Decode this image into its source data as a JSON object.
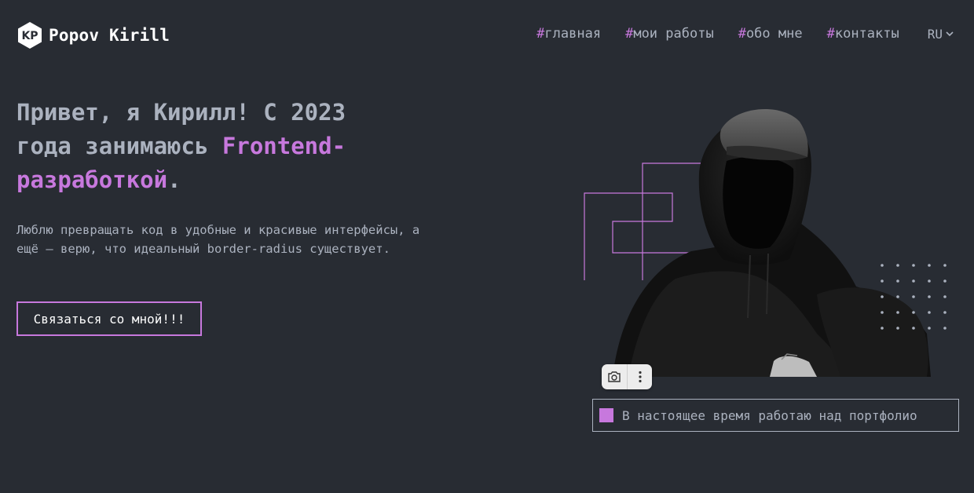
{
  "header": {
    "logo_initials": "KP",
    "logo_name": "Popov Kirill",
    "nav": [
      {
        "hash": "#",
        "label": "главная"
      },
      {
        "hash": "#",
        "label": "мои работы"
      },
      {
        "hash": "#",
        "label": "обо мне"
      },
      {
        "hash": "#",
        "label": "контакты"
      }
    ],
    "language": "RU"
  },
  "hero": {
    "title_part1": "Привет, я Кирилл! С 2023 года занимаюсь ",
    "title_accent": "Frontend-разработкой",
    "title_end": ".",
    "description": "Люблю превращать код в удобные и красивые интерфейсы, а ещё — верю, что идеальный border-radius существует.",
    "button_label": "Связаться со мной!!!"
  },
  "status": {
    "text": "В настоящее время работаю над портфолио"
  },
  "colors": {
    "background": "#282c33",
    "accent": "#c778dd",
    "text": "#abb2bf",
    "white": "#ffffff"
  }
}
